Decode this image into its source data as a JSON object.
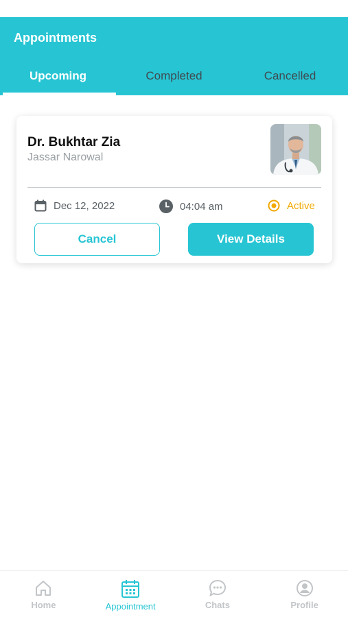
{
  "header": {
    "title": "Appointments"
  },
  "tabs": [
    {
      "label": "Upcoming",
      "active": true
    },
    {
      "label": "Completed",
      "active": false
    },
    {
      "label": "Cancelled",
      "active": false
    }
  ],
  "appointment": {
    "doctor_name": "Dr. Bukhtar Zia",
    "location": "Jassar Narowal",
    "date": "Dec 12, 2022",
    "time": "04:04 am",
    "status": "Active",
    "cancel_label": "Cancel",
    "view_label": "View Details"
  },
  "bottom_nav": [
    {
      "label": "Home",
      "icon": "home-icon",
      "active": false
    },
    {
      "label": "Appointment",
      "icon": "calendar-icon",
      "active": true
    },
    {
      "label": "Chats",
      "icon": "chat-icon",
      "active": false
    },
    {
      "label": "Profile",
      "icon": "profile-icon",
      "active": false
    }
  ],
  "colors": {
    "accent": "#27c5d3",
    "status_active": "#f2a900",
    "inactive": "#c2c5c8"
  }
}
